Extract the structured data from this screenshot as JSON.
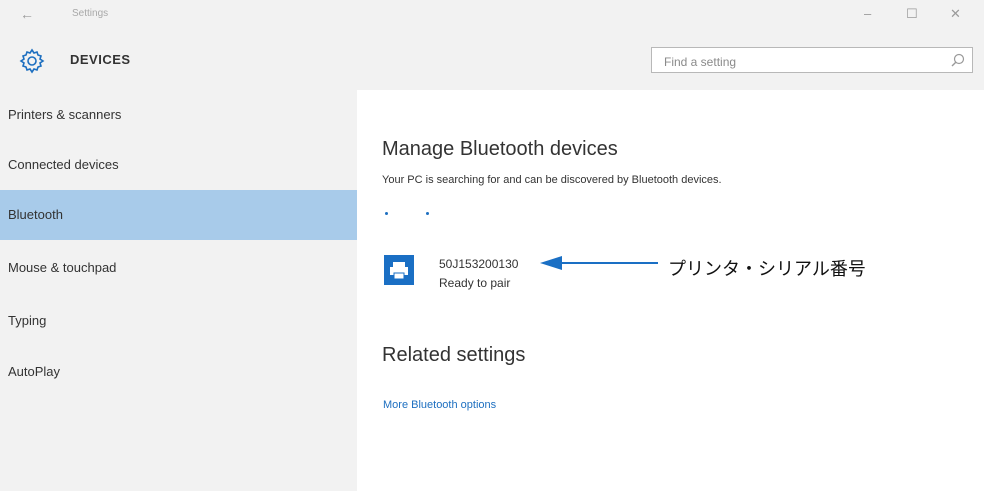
{
  "window": {
    "title": "Settings",
    "back_glyph": "←",
    "controls": {
      "minimize": "–",
      "maximize": "☐",
      "close": "✕"
    }
  },
  "header": {
    "section_title": "DEVICES",
    "icon": "gear-icon",
    "search": {
      "placeholder": "Find a setting",
      "icon": "search-icon"
    }
  },
  "sidebar": {
    "items": [
      {
        "label": "Printers & scanners",
        "active": false
      },
      {
        "label": "Connected devices",
        "active": false
      },
      {
        "label": "Bluetooth",
        "active": true
      },
      {
        "label": "Mouse & touchpad",
        "active": false
      },
      {
        "label": "Typing",
        "active": false
      },
      {
        "label": "AutoPlay",
        "active": false
      }
    ]
  },
  "main": {
    "title": "Manage Bluetooth devices",
    "description": "Your PC is searching for and can be discovered by Bluetooth devices.",
    "device": {
      "name": "50J153200130",
      "status": "Ready to pair",
      "icon": "printer-icon"
    },
    "related_title": "Related settings",
    "related_link": "More Bluetooth options"
  },
  "annotation": {
    "label": "プリンタ・シリアル番号"
  },
  "colors": {
    "accent": "#1d6fc0",
    "selected": "#a8cbea",
    "device_icon_bg": "#1a6fc4"
  }
}
